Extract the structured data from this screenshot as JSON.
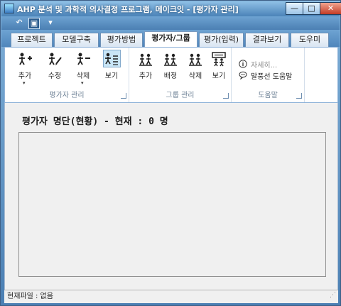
{
  "window": {
    "title": "AHP 분석 및 과학적 의사결정 프로그램, 메이크잇 - [평가자 관리]",
    "min_label": "—",
    "max_label": "□",
    "close_label": "✕"
  },
  "qat": {
    "back_glyph": "↶",
    "save_glyph": "▣",
    "more_glyph": "▾"
  },
  "tabs": [
    {
      "label": "프로젝트"
    },
    {
      "label": "모델구축"
    },
    {
      "label": "평가방법"
    },
    {
      "label": "평가자/그룹"
    },
    {
      "label": "평가(입력)"
    },
    {
      "label": "결과보기"
    },
    {
      "label": "도우미"
    }
  ],
  "ribbon": {
    "evaluator_group": {
      "label": "평가자 관리",
      "buttons": [
        {
          "label": "추가",
          "icon": "add-person-icon"
        },
        {
          "label": "수정",
          "icon": "edit-person-icon"
        },
        {
          "label": "삭제",
          "icon": "remove-person-icon"
        },
        {
          "label": "보기",
          "icon": "view-persons-icon"
        }
      ]
    },
    "group_group": {
      "label": "그룹 관리",
      "buttons": [
        {
          "label": "추가",
          "icon": "add-group-icon"
        },
        {
          "label": "배정",
          "icon": "assign-group-icon"
        },
        {
          "label": "삭제",
          "icon": "remove-group-icon"
        },
        {
          "label": "보기",
          "icon": "view-group-icon"
        }
      ]
    },
    "help_group": {
      "label": "도움말",
      "items": [
        {
          "label": "자세히...",
          "icon": "info-icon"
        },
        {
          "label": "말풍선 도움말",
          "icon": "speech-bubble-icon"
        }
      ]
    }
  },
  "main": {
    "title": "평가자 명단(현황) - 현재 : 0 명"
  },
  "status": {
    "text": "현재파일 : 없음"
  }
}
